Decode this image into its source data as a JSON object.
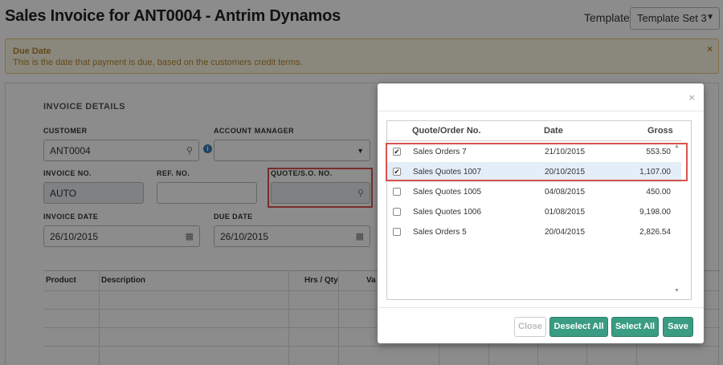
{
  "page": {
    "title": "Sales Invoice for ANT0004 - Antrim Dynamos",
    "template_label": "Template",
    "template_value": "Template Set 3"
  },
  "alert": {
    "title": "Due Date",
    "text": "This is the date that payment is due, based on the customers credit terms.",
    "close": "×"
  },
  "invoice": {
    "section_title": "INVOICE DETAILS",
    "customer_label": "CUSTOMER",
    "customer_value": "ANT0004",
    "account_manager_label": "ACCOUNT MANAGER",
    "account_manager_value": "",
    "invoice_no_label": "INVOICE NO.",
    "invoice_no_value": "AUTO",
    "ref_no_label": "REF. NO.",
    "ref_no_value": "",
    "quote_label": "QUOTE/S.O. NO.",
    "quote_value": "",
    "invoice_date_label": "INVOICE DATE",
    "invoice_date_value": "26/10/2015",
    "due_date_label": "DUE DATE",
    "due_date_value": "26/10/2015"
  },
  "grid": {
    "columns": [
      "Product",
      "Description",
      "Hrs / Qty",
      "Va"
    ]
  },
  "modal": {
    "close_icon": "×",
    "columns": {
      "number": "Quote/Order No.",
      "date": "Date",
      "gross": "Gross"
    },
    "rows": [
      {
        "name": "Sales Orders 7",
        "date": "21/10/2015",
        "gross": "553.50",
        "checked": true
      },
      {
        "name": "Sales Quotes 1007",
        "date": "20/10/2015",
        "gross": "1,107.00",
        "checked": true
      },
      {
        "name": "Sales Quotes 1005",
        "date": "04/08/2015",
        "gross": "450.00",
        "checked": false
      },
      {
        "name": "Sales Quotes 1006",
        "date": "01/08/2015",
        "gross": "9,198.00",
        "checked": false
      },
      {
        "name": "Sales Orders 5",
        "date": "20/04/2015",
        "gross": "2,826.54",
        "checked": false
      }
    ],
    "buttons": {
      "close": "Close",
      "deselect_all": "Deselect All",
      "select_all": "Select All",
      "save": "Save"
    }
  },
  "colors": {
    "accent_green": "#3a9c82",
    "highlight_red": "#d9534f",
    "alert_text": "#b5852f"
  }
}
